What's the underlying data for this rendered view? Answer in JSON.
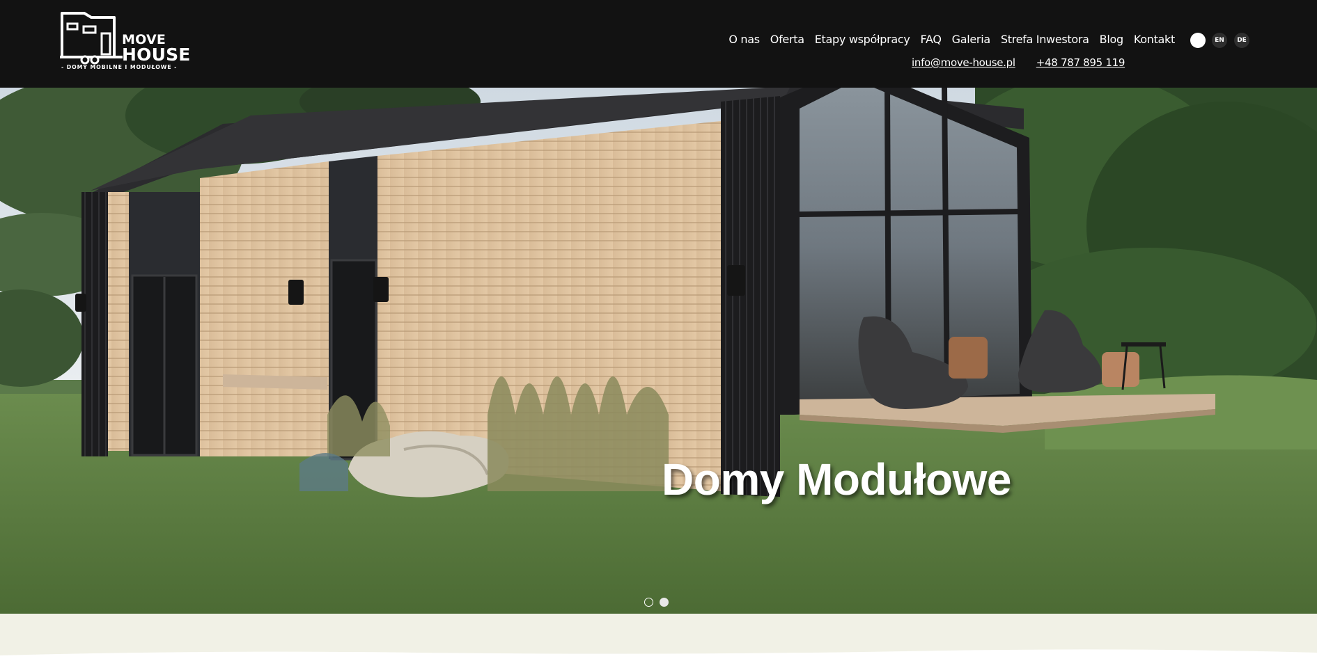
{
  "colors": {
    "header_bg": "#121212",
    "header_text": "#ffffff",
    "band_bg": "#f1f1e6",
    "lang_btn_bg": "#2e2e2e"
  },
  "brand": {
    "line1": "MOVE",
    "line2": "HOUSE",
    "tagline": "- DOMY MOBILNE I MODUŁOWE -",
    "logo_icon": "tiny-house-trailer-icon"
  },
  "nav": {
    "items": [
      {
        "label": "O nas"
      },
      {
        "label": "Oferta"
      },
      {
        "label": "Etapy współpracy"
      },
      {
        "label": "FAQ"
      },
      {
        "label": "Galeria"
      },
      {
        "label": "Strefa Inwestora"
      },
      {
        "label": "Blog"
      },
      {
        "label": "Kontakt"
      }
    ]
  },
  "contact": {
    "email": "info@move-house.pl",
    "phone": "+48 787 895 119"
  },
  "languages": {
    "theme_toggle_icon": "light-mode-toggle-icon",
    "en": "EN",
    "de": "DE"
  },
  "hero": {
    "title": "Domy Modułowe",
    "slides_count": 2,
    "active_slide": 2
  }
}
